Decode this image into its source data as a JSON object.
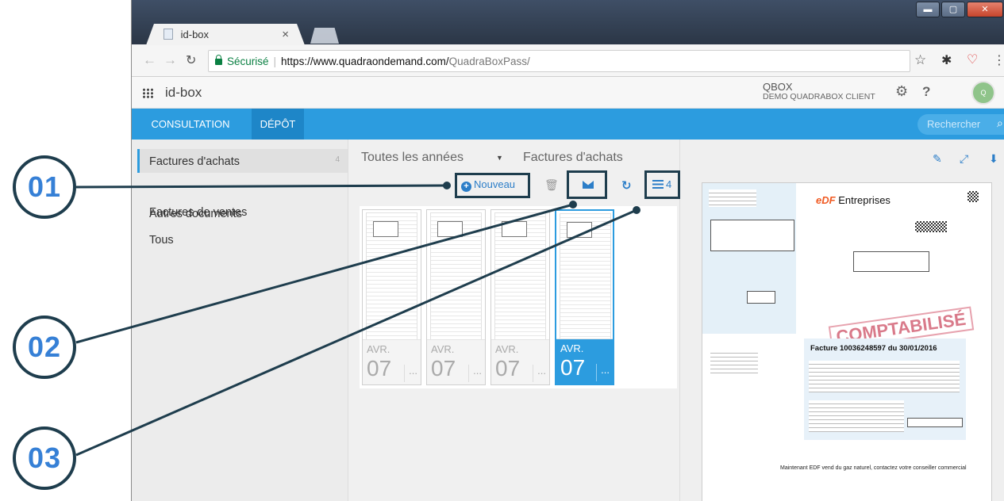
{
  "browser": {
    "tab_title": "id-box",
    "tab_close": "×",
    "secure_label": "Sécurisé",
    "url_host": "https://www.quadraondemand.com/",
    "url_path": "QuadraBoxPass/",
    "window_controls": [
      "▬",
      "▢",
      "✕"
    ]
  },
  "app": {
    "name": "id-box",
    "account_name": "QBOX",
    "account_sub": "DEMO QUADRABOX CLIENT",
    "avatar_initial": "Q"
  },
  "nav": {
    "tabs": [
      {
        "label": "CONSULTATION",
        "active": false
      },
      {
        "label": "DÉPÔT",
        "active": true
      }
    ],
    "search_placeholder": "Rechercher"
  },
  "sidebar": {
    "items": [
      {
        "label": "Factures d'achats",
        "count": "4",
        "active": true
      },
      {
        "label": "Factures de ventes",
        "count": "",
        "active": false
      },
      {
        "label": "Autres documents",
        "count": "",
        "active": false
      },
      {
        "label": "Tous",
        "count": "",
        "active": false
      }
    ]
  },
  "list": {
    "year_filter": "Toutes les années",
    "category_filter": "Factures d'achats",
    "new_label": "Nouveau",
    "list_count": "4",
    "cards": [
      {
        "month": "AVR.",
        "day": "07",
        "more": "...",
        "selected": false
      },
      {
        "month": "AVR.",
        "day": "07",
        "more": "...",
        "selected": false
      },
      {
        "month": "AVR.",
        "day": "07",
        "more": "...",
        "selected": false
      },
      {
        "month": "AVR.",
        "day": "07",
        "more": "...",
        "selected": true
      }
    ]
  },
  "preview": {
    "brand_mark": "eDF",
    "brand_name": "Entreprises",
    "stamp_text": "COMPTABILISÉ",
    "invoice_title": "Facture 10036248597 du 30/01/2016",
    "footer_note": "Maintenant EDF vend du gaz naturel, contactez votre conseiller commercial"
  },
  "callouts": [
    "01",
    "02",
    "03"
  ],
  "colors": {
    "accent_blue": "#2c9cdf",
    "callout_dark": "#1e3d4d",
    "callout_number": "#3680d6"
  }
}
